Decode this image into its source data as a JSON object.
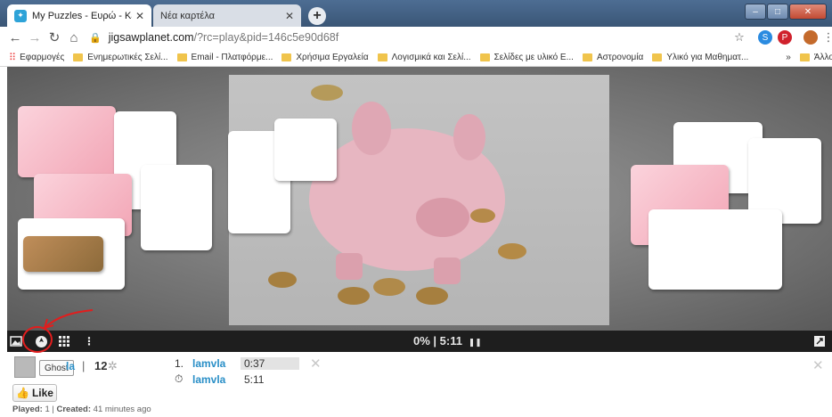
{
  "browser": {
    "tabs": [
      {
        "title": "My Puzzles - Ευρώ - Κέρματα - J",
        "active": true
      },
      {
        "title": "Νέα καρτέλα",
        "active": false
      }
    ],
    "url_host": "jigsawplanet.com",
    "url_path": "/?rc=play&pid=146c5e90d68f",
    "bookmarks": [
      "Εφαρμογές",
      "Ενημερωτικές Σελί...",
      "Email - Πλατφόρμε...",
      "Χρήσιμα Εργαλεία",
      "Λογισμικά και Σελί...",
      "Σελίδες με υλικό Ε...",
      "Αστρονομία",
      "Υλικό για Μαθηματ..."
    ],
    "bookmarks_more": "»",
    "other_bookmarks": "Άλλοι σελιδοδείκτε"
  },
  "puzzle": {
    "progress_text": "0% | 5:11",
    "pause_glyph": "❚❚"
  },
  "player": {
    "ghost_tooltip": "Ghost",
    "name_fragment": "la",
    "separator": "|",
    "pieces_count": "12"
  },
  "scores": [
    {
      "rank": "1.",
      "name": "lamvla",
      "time": "0:37"
    },
    {
      "rank": "⏱",
      "name": "lamvla",
      "time": "5:11"
    }
  ],
  "like": {
    "label": "Like"
  },
  "meta": {
    "played_label": "Played:",
    "played_value": "1",
    "created_label": "Created:",
    "created_value": "41 minutes ago"
  },
  "icons": {
    "image": "image-icon",
    "ghost": "ghost-icon",
    "grid": "grid-icon",
    "menu": "more-vertical-icon",
    "fullscreen": "fullscreen-icon"
  },
  "colors": {
    "accent_link": "#2a8fc7",
    "annotation_red": "#e21d1d",
    "stage_bar": "#1e1e1e"
  }
}
